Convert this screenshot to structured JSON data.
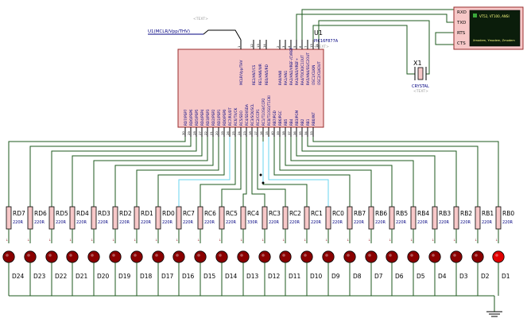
{
  "mcu": {
    "ref": "U1",
    "part": "PIC16F877A",
    "text_placeholder": "<TEXT>",
    "mclr_net": "U1(MCLR/Vpp/THV)",
    "mclr_text": "<TEXT>",
    "mclr_pin_label": "MCLR/Vpp/THV",
    "top_pins": [
      {
        "num": "1",
        "label": "MCLR/Vpp/THV"
      },
      {
        "num": "12",
        "label": "RE2/AN7/CS"
      },
      {
        "num": "13",
        "label": "RE1/AN6/WR"
      },
      {
        "num": "14",
        "label": "RE0/AN5/RD"
      },
      {
        "num": "2",
        "label": "RA0/AN0"
      },
      {
        "num": "3",
        "label": "RA1/AN1"
      },
      {
        "num": "4",
        "label": "RA2/AN2/VREF-/CVREF"
      },
      {
        "num": "5",
        "label": "RA3/AN3/VREF+"
      },
      {
        "num": "6",
        "label": "RA4/T0CKI/C1OUT"
      },
      {
        "num": "7",
        "label": "RA5/AN4/SS/C2OUT"
      },
      {
        "num": "13",
        "label": "OSC1/CLKIN"
      },
      {
        "num": "14",
        "label": "OSC2/CLKOUT"
      }
    ],
    "bottom_pins": [
      {
        "num": "30",
        "label": "RD7/PSP7"
      },
      {
        "num": "29",
        "label": "RD6/PSP6"
      },
      {
        "num": "28",
        "label": "RD5/PSP5"
      },
      {
        "num": "27",
        "label": "RD4/PSP4"
      },
      {
        "num": "22",
        "label": "RD3/PSP3"
      },
      {
        "num": "21",
        "label": "RD2/PSP2"
      },
      {
        "num": "20",
        "label": "RD1/PSP1"
      },
      {
        "num": "19",
        "label": "RD0/PSP0"
      },
      {
        "num": "26",
        "label": "RC7/RX/DT"
      },
      {
        "num": "25",
        "label": "RC6/TX/CK"
      },
      {
        "num": "24",
        "label": "RC5/SDO"
      },
      {
        "num": "23",
        "label": "RC4/SDI/SDA"
      },
      {
        "num": "18",
        "label": "RC3/SCK/SCL"
      },
      {
        "num": "17",
        "label": "RC2/CCP1"
      },
      {
        "num": "16",
        "label": "RC1/T1OSI/CCP2"
      },
      {
        "num": "15",
        "label": "RC0/T1OSO/T1CKI"
      },
      {
        "num": "40",
        "label": "RB7/PGD"
      },
      {
        "num": "39",
        "label": "RB6/PGC"
      },
      {
        "num": "38",
        "label": "RB5"
      },
      {
        "num": "37",
        "label": "RB4"
      },
      {
        "num": "36",
        "label": "RB3/PGM"
      },
      {
        "num": "35",
        "label": "RB2"
      },
      {
        "num": "34",
        "label": "RB1"
      },
      {
        "num": "33",
        "label": "RB0/INT"
      }
    ]
  },
  "crystal": {
    "ref": "X1",
    "part": "CRYSTAL",
    "text": "<TEXT>"
  },
  "terminal": {
    "pins": [
      "RXD",
      "TXD",
      "RTS",
      "CTS"
    ],
    "screen_title": "VT52, VT100, ANSI",
    "screen_sub": "Xmodem, Ymodem, Zmodem"
  },
  "resistors": [
    {
      "ref": "RD7",
      "value": "220R"
    },
    {
      "ref": "RD6",
      "value": "220R"
    },
    {
      "ref": "RD5",
      "value": "220R"
    },
    {
      "ref": "RD4",
      "value": "220R"
    },
    {
      "ref": "RD3",
      "value": "220R"
    },
    {
      "ref": "RD2",
      "value": "220R"
    },
    {
      "ref": "RD1",
      "value": "220R"
    },
    {
      "ref": "RD0",
      "value": "220R"
    },
    {
      "ref": "RC7",
      "value": "220R"
    },
    {
      "ref": "RC6",
      "value": "220R"
    },
    {
      "ref": "RC5",
      "value": "220R"
    },
    {
      "ref": "RC4",
      "value": "330R"
    },
    {
      "ref": "RC3",
      "value": "220R"
    },
    {
      "ref": "RC2",
      "value": "220R"
    },
    {
      "ref": "RC1",
      "value": "220R"
    },
    {
      "ref": "RC0",
      "value": "220R"
    },
    {
      "ref": "RB7",
      "value": "220R"
    },
    {
      "ref": "RB6",
      "value": "220R"
    },
    {
      "ref": "RB5",
      "value": "220R"
    },
    {
      "ref": "RB4",
      "value": "220R"
    },
    {
      "ref": "RB3",
      "value": "220R"
    },
    {
      "ref": "RB2",
      "value": "220R"
    },
    {
      "ref": "RB1",
      "value": "220R"
    },
    {
      "ref": "RB0",
      "value": "220R"
    }
  ],
  "leds": [
    {
      "ref": "D24",
      "on": false
    },
    {
      "ref": "D23",
      "on": false
    },
    {
      "ref": "D22",
      "on": false
    },
    {
      "ref": "D21",
      "on": false
    },
    {
      "ref": "D20",
      "on": false
    },
    {
      "ref": "D19",
      "on": false
    },
    {
      "ref": "D18",
      "on": false
    },
    {
      "ref": "D17",
      "on": false
    },
    {
      "ref": "D16",
      "on": false
    },
    {
      "ref": "D15",
      "on": false
    },
    {
      "ref": "D14",
      "on": false
    },
    {
      "ref": "D13",
      "on": false
    },
    {
      "ref": "D12",
      "on": false
    },
    {
      "ref": "D11",
      "on": false
    },
    {
      "ref": "D10",
      "on": false
    },
    {
      "ref": "D9",
      "on": false
    },
    {
      "ref": "D8",
      "on": false
    },
    {
      "ref": "D7",
      "on": false
    },
    {
      "ref": "D6",
      "on": false
    },
    {
      "ref": "D5",
      "on": false
    },
    {
      "ref": "D4",
      "on": false
    },
    {
      "ref": "D3",
      "on": false
    },
    {
      "ref": "D2",
      "on": false
    },
    {
      "ref": "D1",
      "on": true
    }
  ],
  "colors": {
    "wire": "#1e5a1e",
    "net_highlight": "#6ad4ef",
    "component_body": "#f7c8c8",
    "component_outline": "#9a2b2b",
    "label_text": "#000080",
    "led_off": "#8a0000",
    "led_on": "#e00000",
    "terminal_screen": "#0b1d0b",
    "terminal_text": "#ffff80"
  }
}
